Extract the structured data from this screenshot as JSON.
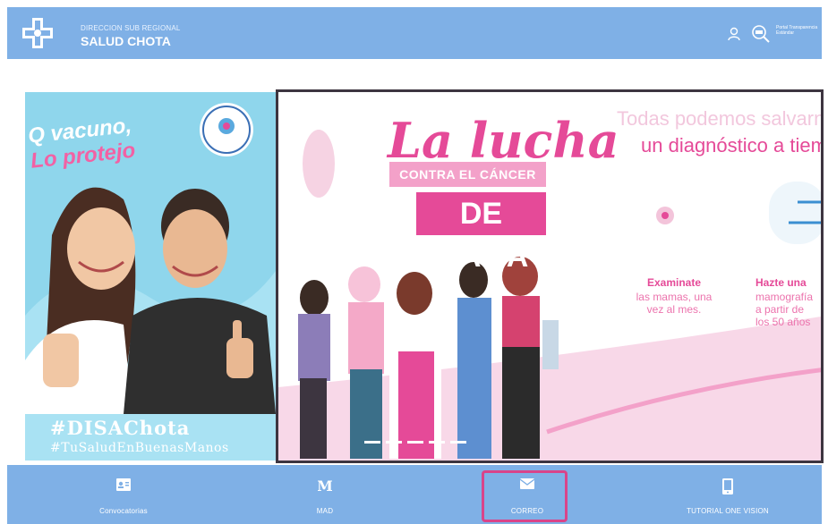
{
  "header": {
    "org_subtitle": "DIRECCION SUB REGIONAL",
    "org_title": "SALUD CHOTA",
    "transparency_text": "Portal Transparencia Estándar"
  },
  "left_banner": {
    "slogan_line1": "Q vacuno,",
    "slogan_line2": "Lo protejo",
    "hashtag1": "#DISAChota",
    "hashtag2": "#TuSaludEnBuenasManos"
  },
  "right_banner": {
    "title": "La lucha",
    "ribbon": "CONTRA EL CÁNCER",
    "box": "DE MAMA",
    "tagline_line1": "Todas podemos salvarnos",
    "tagline_line2": "un diagnóstico a tiempo",
    "tip1_title": "Examinate",
    "tip1_line1": "las mamas, una",
    "tip1_line2": "vez al mes.",
    "tip2_title": "Hazte una",
    "tip2_line1": "mamografía",
    "tip2_line2": "a partir de",
    "tip2_line3": "los 50 años"
  },
  "nav": {
    "items": [
      {
        "label": "Convocatorias",
        "icon": "id-card-icon"
      },
      {
        "label": "MAD",
        "icon": "mad-letter-icon"
      },
      {
        "label": "CORREO",
        "icon": "envelope-icon"
      },
      {
        "label": "TUTORIAL ONE VISION",
        "icon": "tablet-icon"
      }
    ]
  },
  "colors": {
    "header_bg": "#7fb0e6",
    "accent_pink": "#e54a98",
    "highlight_border": "#d9448a",
    "left_banner_bg": "#8fd6ec"
  }
}
